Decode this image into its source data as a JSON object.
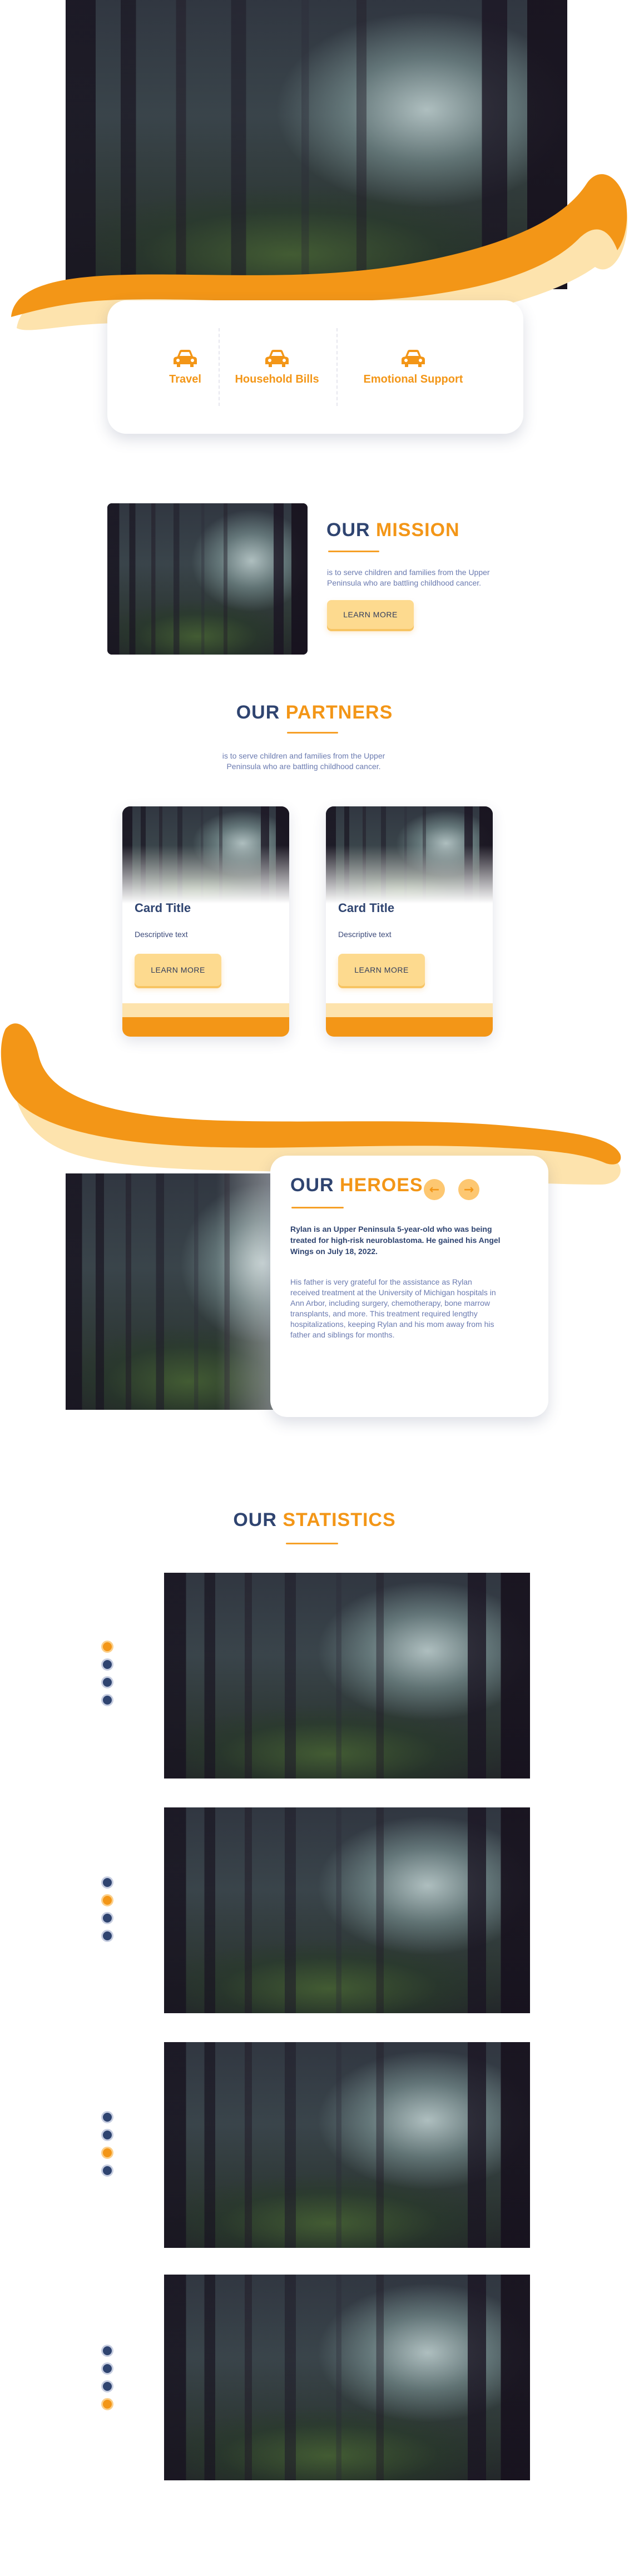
{
  "services": [
    {
      "label": "Travel",
      "icon": "car-icon"
    },
    {
      "label": "Household Bills",
      "icon": "car-icon"
    },
    {
      "label": "Emotional Support",
      "icon": "car-icon"
    }
  ],
  "mission": {
    "title_a": "OUR",
    "title_b": "MISSION",
    "text": "is to serve children and families from the Upper Peninsula who are battling childhood cancer.",
    "button": "LEARN MORE"
  },
  "partners": {
    "title_a": "OUR",
    "title_b": "PARTNERS",
    "text": "is to serve children and families from the Upper Peninsula who are battling childhood cancer.",
    "cards": [
      {
        "title": "Card Title",
        "desc": "Descriptive text",
        "button": "LEARN MORE"
      },
      {
        "title": "Card Title",
        "desc": "Descriptive text",
        "button": "LEARN MORE"
      }
    ]
  },
  "heroes": {
    "title_a": "OUR",
    "title_b": "HEROES",
    "prev_icon": "arrow-left-icon",
    "next_icon": "arrow-right-icon",
    "lead": "Rylan is an Upper Peninsula 5-year-old who was being treated for high-risk neuroblastoma. He gained his Angel Wings on July 18, 2022.",
    "body": "His father is very grateful for the assistance as Rylan received treatment at the University of Michigan hospitals in Ann Arbor, including surgery, chemotherapy, bone marrow transplants, and more. This treatment required lengthy hospitalizations, keeping Rylan and his mom away from his father and siblings for months."
  },
  "statistics": {
    "title_a": "OUR",
    "title_b": "STATISTICS",
    "slides": [
      {
        "active_dot": 1
      },
      {
        "active_dot": 2
      },
      {
        "active_dot": 3
      },
      {
        "active_dot": 4
      }
    ]
  },
  "colors": {
    "accent": "#f39617",
    "navy": "#2f4470",
    "button": "#fdda8f"
  }
}
